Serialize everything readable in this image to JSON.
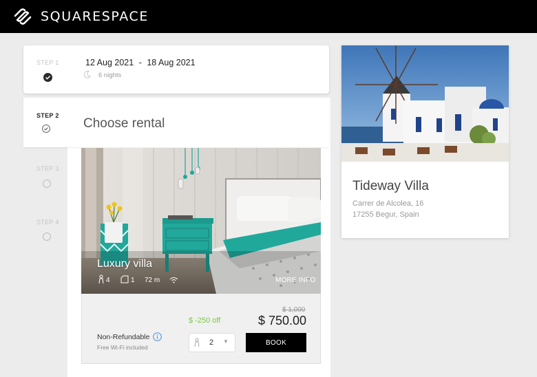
{
  "brand": {
    "name": "SQUARESPACE",
    "logo_icon": "squarespace-logo-icon"
  },
  "steps": [
    {
      "label": "STEP 1",
      "state": "done"
    },
    {
      "label": "STEP 2",
      "state": "active"
    },
    {
      "label": "STEP 3",
      "state": "pending"
    },
    {
      "label": "STEP 4",
      "state": "pending"
    }
  ],
  "stay": {
    "check_in": "12 Aug 2021",
    "separator": "-",
    "check_out": "18 Aug 2021",
    "nights": "6 nights",
    "nights_icon": "moon-icon"
  },
  "rental": {
    "heading": "Choose rental",
    "title": "Luxury villa",
    "guests": "4",
    "beds": "1",
    "area": "72 m",
    "more_info": "MORE INFO",
    "old_price": "$ 1,000",
    "discount": "$ -250 off",
    "price": "$ 750.00",
    "policy": "Non-Refundable",
    "wifi_note": "Free Wi-Fi included",
    "guest_select_value": "2",
    "book_label": "BOOK"
  },
  "property": {
    "name": "Tideway Villa",
    "address_line1": "Carrer de Alcolea, 16",
    "address_line2": "17255 Begur, Spain"
  },
  "colors": {
    "accent_green": "#7ac943",
    "teal": "#1fa89c",
    "dark": "#000000"
  }
}
